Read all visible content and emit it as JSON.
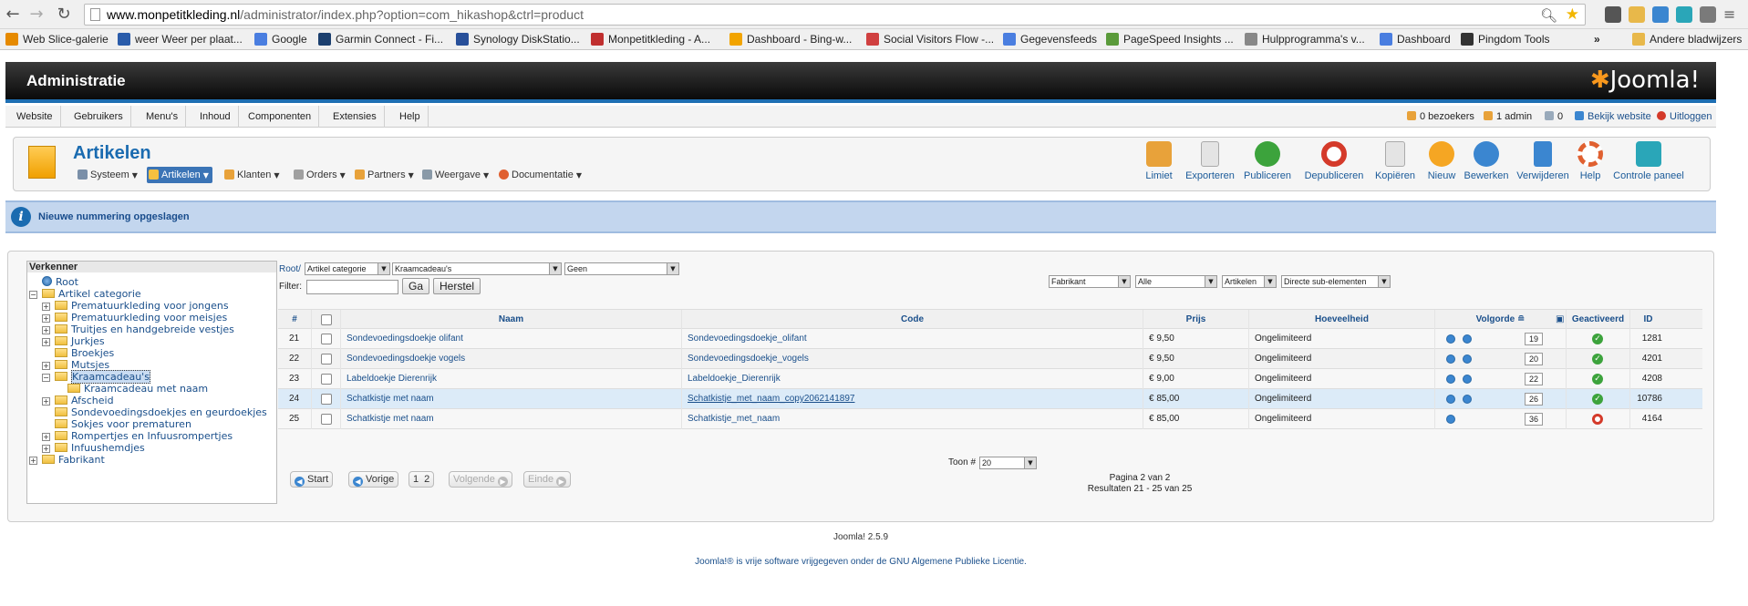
{
  "browser": {
    "url_host": "www.monpetitkleding.nl",
    "url_path": "/administrator/index.php?option=com_hikashop&ctrl=product",
    "bookmarks": [
      {
        "label": "Web Slice-galerie",
        "color": "#e68a00"
      },
      {
        "label": "weer Weer per plaat...",
        "color": "#2a5caa"
      },
      {
        "label": "Google",
        "color": "#4a7ee0"
      },
      {
        "label": "Garmin Connect - Fi...",
        "color": "#1b3f6e"
      },
      {
        "label": "Synology DiskStatio...",
        "color": "#28509a"
      },
      {
        "label": "Monpetitkleding - A...",
        "color": "#c03030"
      },
      {
        "label": "Dashboard - Bing-w...",
        "color": "#f2a400"
      },
      {
        "label": "Social Visitors Flow -...",
        "color": "#d04040"
      },
      {
        "label": "Gegevensfeeds",
        "color": "#4a7ee0"
      },
      {
        "label": "PageSpeed Insights ...",
        "color": "#5a9a3a"
      },
      {
        "label": "Hulpprogramma's v...",
        "color": "#888888"
      },
      {
        "label": "Dashboard",
        "color": "#4a7ee0"
      },
      {
        "label": "Pingdom Tools",
        "color": "#333333"
      },
      {
        "label": "»",
        "color": ""
      },
      {
        "label": "Andere bladwijzers",
        "color": "#e8b84a"
      }
    ]
  },
  "header": {
    "title": "Administratie",
    "logo": "Joomla!"
  },
  "menu": {
    "items": [
      "Website",
      "Gebruikers",
      "Menu's",
      "Inhoud",
      "Componenten",
      "Extensies",
      "Help"
    ],
    "status": {
      "visitors": "0 bezoekers",
      "admins": "1 admin",
      "messages": "0",
      "view_site": "Bekijk website",
      "logout": "Uitloggen"
    }
  },
  "toolbar": {
    "title": "Artikelen",
    "submenu": [
      "Systeem",
      "Artikelen",
      "Klanten",
      "Orders",
      "Partners",
      "Weergave",
      "Documentatie"
    ],
    "buttons": [
      {
        "label": "Limiet",
        "color": "#e8a23a"
      },
      {
        "label": "Exporteren",
        "color": "#dddddd"
      },
      {
        "label": "Publiceren",
        "color": "#3ca33c"
      },
      {
        "label": "Depubliceren",
        "color": "#d43a2a"
      },
      {
        "label": "Kopiëren",
        "color": "#dddddd"
      },
      {
        "label": "Nieuw",
        "color": "#f5a623"
      },
      {
        "label": "Bewerken",
        "color": "#3b86d0"
      },
      {
        "label": "Verwijderen",
        "color": "#3b86d0"
      },
      {
        "label": "Help",
        "color": "#e06030"
      },
      {
        "label": "Controle paneel",
        "color": "#2aa6b8"
      }
    ]
  },
  "message": {
    "text": "Nieuwe nummering opgeslagen"
  },
  "tree": {
    "heading": "Verkenner",
    "nodes": [
      {
        "label": "Root",
        "level": 0,
        "pm": "",
        "icon": "globe"
      },
      {
        "label": "Artikel categorie",
        "level": 0,
        "pm": "−",
        "icon": "folder"
      },
      {
        "label": "Prematuurkleding voor jongens",
        "level": 1,
        "pm": "+",
        "icon": "folder"
      },
      {
        "label": "Prematuurkleding voor meisjes",
        "level": 1,
        "pm": "+",
        "icon": "folder"
      },
      {
        "label": "Truitjes en handgebreide vestjes",
        "level": 1,
        "pm": "+",
        "icon": "folder"
      },
      {
        "label": "Jurkjes",
        "level": 1,
        "pm": "+",
        "icon": "folder"
      },
      {
        "label": "Broekjes",
        "level": 1,
        "pm": "",
        "icon": "folder"
      },
      {
        "label": "Mutsjes",
        "level": 1,
        "pm": "+",
        "icon": "folder"
      },
      {
        "label": "Kraamcadeau's",
        "level": 1,
        "pm": "−",
        "icon": "folder",
        "selected": true
      },
      {
        "label": "Kraamcadeau met naam",
        "level": 2,
        "pm": "",
        "icon": "folder"
      },
      {
        "label": "Afscheid",
        "level": 1,
        "pm": "+",
        "icon": "folder"
      },
      {
        "label": "Sondevoedingsdoekjes en geurdoekjes",
        "level": 1,
        "pm": "",
        "icon": "folder"
      },
      {
        "label": "Sokjes voor prematuren",
        "level": 1,
        "pm": "",
        "icon": "folder"
      },
      {
        "label": "Rompertjes en Infuusrompertjes",
        "level": 1,
        "pm": "+",
        "icon": "folder"
      },
      {
        "label": "Infuushemdjes",
        "level": 1,
        "pm": "+",
        "icon": "folder"
      },
      {
        "label": "Fabrikant",
        "level": 0,
        "pm": "+",
        "icon": "folder"
      }
    ]
  },
  "filters": {
    "breadcrumb": "Root/",
    "category_type": "Artikel categorie",
    "category": "Kraamcadeau's",
    "geen": "Geen",
    "filter_label": "Filter:",
    "filter_value": "",
    "go_label": "Ga",
    "reset_label": "Herstel",
    "fabrikant": "Fabrikant",
    "alle": "Alle",
    "artikelen": "Artikelen",
    "sub_elements": "Directe sub-elementen"
  },
  "table": {
    "headers": {
      "num": "#",
      "name": "Naam",
      "code": "Code",
      "price": "Prijs",
      "qty": "Hoeveelheid",
      "order": "Volgorde",
      "active": "Geactiveerd",
      "id": "ID"
    },
    "rows": [
      {
        "num": "21",
        "name": "Sondevoedingsdoekje olifant",
        "code": "Sondevoedingsdoekje_olifant",
        "price": "€ 9,50",
        "qty": "Ongelimiteerd",
        "order": "19",
        "published": true,
        "id": "1281",
        "arrows": 2
      },
      {
        "num": "22",
        "name": "Sondevoedingsdoekje vogels",
        "code": "Sondevoedingsdoekje_vogels",
        "price": "€ 9,50",
        "qty": "Ongelimiteerd",
        "order": "20",
        "published": true,
        "id": "4201",
        "arrows": 2
      },
      {
        "num": "23",
        "name": "Labeldoekje Dierenrijk",
        "code": "Labeldoekje_Dierenrijk",
        "price": "€ 9,00",
        "qty": "Ongelimiteerd",
        "order": "22",
        "published": true,
        "id": "4208",
        "arrows": 2
      },
      {
        "num": "24",
        "name": "Schatkistje met naam",
        "code": "Schatkistje_met_naam_copy2062141897",
        "price": "€ 85,00",
        "qty": "Ongelimiteerd",
        "order": "26",
        "published": true,
        "id": "10786",
        "arrows": 2
      },
      {
        "num": "25",
        "name": "Schatkistje met naam",
        "code": "Schatkistje_met_naam",
        "price": "€ 85,00",
        "qty": "Ongelimiteerd",
        "order": "36",
        "published": false,
        "id": "4164",
        "arrows": 1
      }
    ]
  },
  "pagination": {
    "start": "Start",
    "prev": "Vorige",
    "page1": "1",
    "page2": "2",
    "next": "Volgende",
    "end": "Einde",
    "show_label": "Toon #",
    "show_value": "20",
    "page_info": "Pagina 2 van 2",
    "results": "Resultaten 21 - 25 van 25"
  },
  "footer": {
    "version": "Joomla! 2.5.9",
    "license_prefix": "Joomla!® is vrije software vrijgegeven onder de",
    "license_link": "GNU Algemene Publieke Licentie."
  }
}
